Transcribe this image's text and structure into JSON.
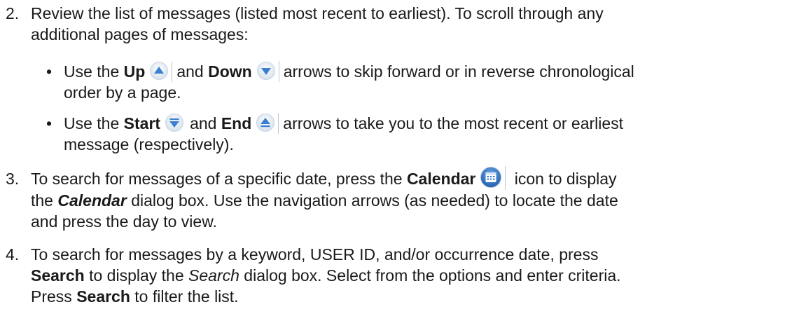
{
  "steps": [
    {
      "number": "2.",
      "line1": "Review the list of messages (listed most recent to earliest). To scroll through any",
      "line2": "additional pages of messages:",
      "bullets": [
        {
          "use": "Use the",
          "b1": "Up",
          "and": "and",
          "b2": "Down",
          "tail1": "arrows to skip forward or in reverse chronological",
          "line2": "order by a page."
        },
        {
          "use": "Use the",
          "b1": "Start",
          "and": "and",
          "b2": "End",
          "tail1": "arrows to take you to the most recent or earliest",
          "line2": "message (respectively)."
        }
      ]
    },
    {
      "number": "3.",
      "pre": "To search for messages of a specific date, press the",
      "bold": "Calendar",
      "post": "icon to display",
      "l2_pre": "the",
      "l2_bi": "Calendar",
      "l2_post": "dialog box. Use the navigation arrows (as needed) to locate the date",
      "line3": "and press the day to view."
    },
    {
      "number": "4.",
      "line1": "To search for messages by a keyword, USER ID, and/or occurrence date, press",
      "l2_bold": "Search",
      "l2_pre": "to display the",
      "l2_italic": "Search",
      "l2_post": "dialog box. Select from the options and enter criteria.",
      "l3_pre": "Press",
      "l3_bold": "Search",
      "l3_post": "to filter the list."
    }
  ],
  "bullet_char": "•",
  "icons": {
    "up": "up-arrow-icon",
    "down": "down-arrow-icon",
    "start": "start-arrow-icon",
    "end": "end-arrow-icon",
    "calendar": "calendar-icon"
  },
  "colors": {
    "icon_blue": "#3a7fd0",
    "icon_ring": "#c9d6e4",
    "text": "#1a1a1a"
  }
}
